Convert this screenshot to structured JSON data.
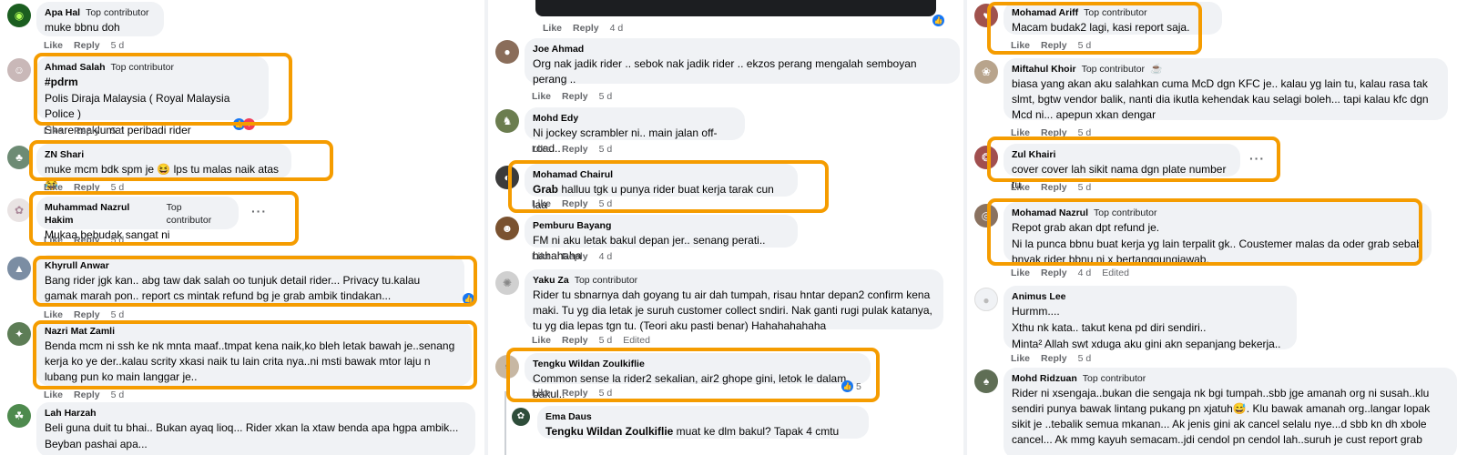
{
  "badge": "Top contributor",
  "actions": {
    "like": "Like",
    "reply": "Reply"
  },
  "col1": {
    "c1": {
      "name": "Apa Hal",
      "badge": "Top contributor",
      "text": "muke bbnu doh",
      "time": "5 d"
    },
    "c2": {
      "name": "Ahmad Salah",
      "badge": "Top contributor",
      "tag": "#pdrm",
      "line1": "Polis Diraja Malaysia ( Royal Malaysia Police )",
      "line2": "Share maklumat peribadi rider",
      "time": "5 d"
    },
    "c3": {
      "name": "ZN Shari",
      "text": "muke mcm bdk spm je 😆 lps tu malas naik atas😂",
      "time": "5 d"
    },
    "c4": {
      "name": "Muhammad Nazrul Hakim",
      "badge": "Top contributor",
      "text": "Mukaa bebudak sangat ni",
      "time": "5 d"
    },
    "c5": {
      "name": "Khyrull Anwar",
      "text": "Bang rider jgk kan.. abg taw dak salah oo tunjuk detail rider... Privacy tu.kalau gamak marah pon.. report cs mintak refund bg je grab ambik tindakan...",
      "time": "5 d"
    },
    "c6": {
      "name": "Nazri Mat Zamli",
      "text": "Benda mcm ni ssh ke nk mnta maaf..tmpat kena naik,ko bleh letak bawah je..senang kerja ko ye der..kalau scrity xkasi naik tu lain crita nya..ni msti bawak mtor laju n lubang pun ko main langgar je..",
      "time": "5 d"
    },
    "c7": {
      "name": "Lah Harzah",
      "line1": "Beli guna duit tu bhai.. Bukan ayaq lioq... Rider xkan la xtaw benda apa hgpa ambik...",
      "line2": "Beyban pashai apa..."
    }
  },
  "col2": {
    "c0": {
      "time": "4 d"
    },
    "c1": {
      "name": "Joe Ahmad",
      "text": "Org nak jadik rider .. sebok nak jadik rider .. ekzos perang mengalah semboyan perang ..",
      "time": "5 d"
    },
    "c2": {
      "name": "Mohd Edy",
      "text": "Ni jockey scrambler ni.. main jalan off-road..",
      "time": "5 d"
    },
    "c3": {
      "name": "Mohamad Chairul",
      "tag": "Grab",
      "text": " halluu tgk u punya rider buat kerja tarak cun laa",
      "time": "5 d"
    },
    "c4": {
      "name": "Pemburu Bayang",
      "text": "FM ni aku letak bakul depan jer.. senang perati.. hahahaha",
      "time": "4 d"
    },
    "c5": {
      "name": "Yaku Za",
      "badge": "Top contributor",
      "text": "Rider tu sbnarnya dah goyang tu air dah tumpah, risau hntar depan2 confirm kena maki. Tu yg dia letak je suruh customer collect sndiri. Nak ganti rugi pulak katanya, tu yg dia lepas tgn tu. (Teori aku pasti benar) Hahahahahaha",
      "time": "5 d",
      "edited": "Edited"
    },
    "c6": {
      "name": "Tengku Wildan Zoulkiflie",
      "text": "Common sense la rider2 sekalian, air2 ghope gini, letok le dalam bakul..",
      "time": "5 d",
      "likes": "5"
    },
    "c7": {
      "name": "Ema Daus",
      "tag": "Tengku Wildan Zoulkiflie",
      "text": " muat ke dlm bakul? Tapak 4 cmtu"
    }
  },
  "col3": {
    "c1": {
      "name": "Mohamad Ariff",
      "badge": "Top contributor",
      "text": "Macam budak2 lagi, kasi report saja.",
      "time": "5 d"
    },
    "c2": {
      "name": "Miftahul Khoir",
      "badge": "Top contributor",
      "text": "biasa yang akan aku salahkan cuma McD dgn KFC je.. kalau yg lain tu, kalau rasa tak slmt, bgtw vendor balik, nanti dia ikutla kehendak kau selagi boleh... tapi kalau kfc dgn Mcd ni... apepun xkan dengar",
      "time": "5 d"
    },
    "c3": {
      "name": "Zul Khairi",
      "text": "cover cover lah sikit nama dgn plate number tu..",
      "time": "5 d"
    },
    "c4": {
      "name": "Mohamad Nazrul",
      "badge": "Top contributor",
      "line1": "Repot grab akan dpt refund je.",
      "line2": "Ni la punca bbnu buat kerja yg lain terpalit gk.. Coustemer malas da oder grab sebab bnyak rider bbnu ni x bertanggungjawab.",
      "time": "4 d",
      "edited": "Edited"
    },
    "c5": {
      "name": "Animus Lee",
      "line1": "Hurmm....",
      "line2": "Xthu nk kata.. takut kena pd diri sendiri..",
      "line3": "Minta² Allah swt xduga aku gini akn sepanjang bekerja..",
      "time": "5 d"
    },
    "c6": {
      "name": "Mohd Ridzuan",
      "badge": "Top contributor",
      "text": "Rider ni xsengaja..bukan die sengaja nk bgi tumpah..sbb jge amanah org ni susah..klu sendiri punya bawak lintang pukang pn xjatuh😅. Klu bawak amanah org..langar lopak sikit je ..tebalik semua mkanan... Ak jenis gini ak cancel selalu nye...d sbb kn dh xbole cancel... Ak mmg kayuh semacam..jdi cendol pn cendol lah..suruh je cust report grab"
    }
  }
}
